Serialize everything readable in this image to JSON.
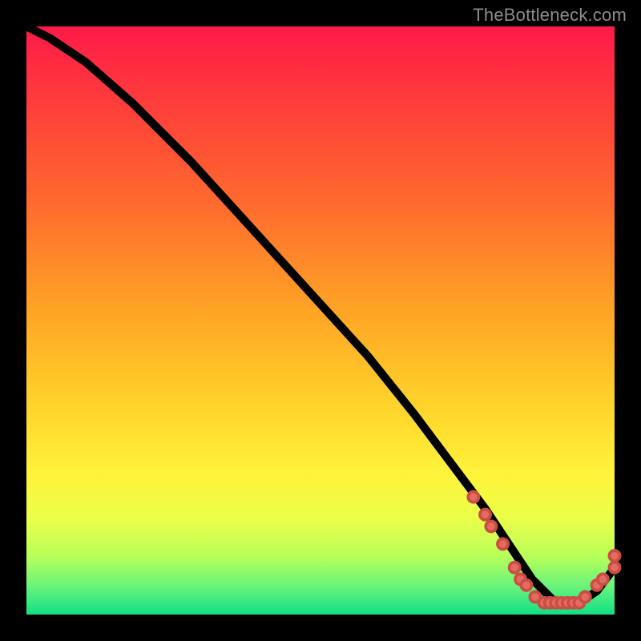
{
  "watermark": "TheBottleneck.com",
  "chart_data": {
    "type": "line",
    "title": "",
    "xlabel": "",
    "ylabel": "",
    "xlim": [
      0,
      100
    ],
    "ylim": [
      0,
      100
    ],
    "curve": {
      "x": [
        0,
        4,
        10,
        18,
        28,
        38,
        48,
        58,
        66,
        72,
        78,
        82,
        86,
        90,
        94,
        97,
        100
      ],
      "y": [
        100,
        98,
        94,
        87,
        77,
        66,
        55,
        44,
        34,
        26,
        18,
        12,
        6,
        2,
        2,
        4,
        8
      ]
    },
    "series": [
      {
        "name": "markers",
        "type": "scatter",
        "points": [
          {
            "x": 76,
            "y": 20
          },
          {
            "x": 78,
            "y": 17
          },
          {
            "x": 79,
            "y": 15
          },
          {
            "x": 81,
            "y": 12
          },
          {
            "x": 83,
            "y": 8
          },
          {
            "x": 84,
            "y": 6
          },
          {
            "x": 85,
            "y": 5
          },
          {
            "x": 86.5,
            "y": 3
          },
          {
            "x": 88,
            "y": 2
          },
          {
            "x": 89,
            "y": 2
          },
          {
            "x": 90,
            "y": 2
          },
          {
            "x": 91,
            "y": 2
          },
          {
            "x": 92,
            "y": 2
          },
          {
            "x": 93,
            "y": 2
          },
          {
            "x": 94,
            "y": 2
          },
          {
            "x": 95,
            "y": 3
          },
          {
            "x": 97,
            "y": 5
          },
          {
            "x": 98,
            "y": 6
          },
          {
            "x": 100,
            "y": 8
          },
          {
            "x": 100,
            "y": 10
          }
        ]
      }
    ]
  }
}
